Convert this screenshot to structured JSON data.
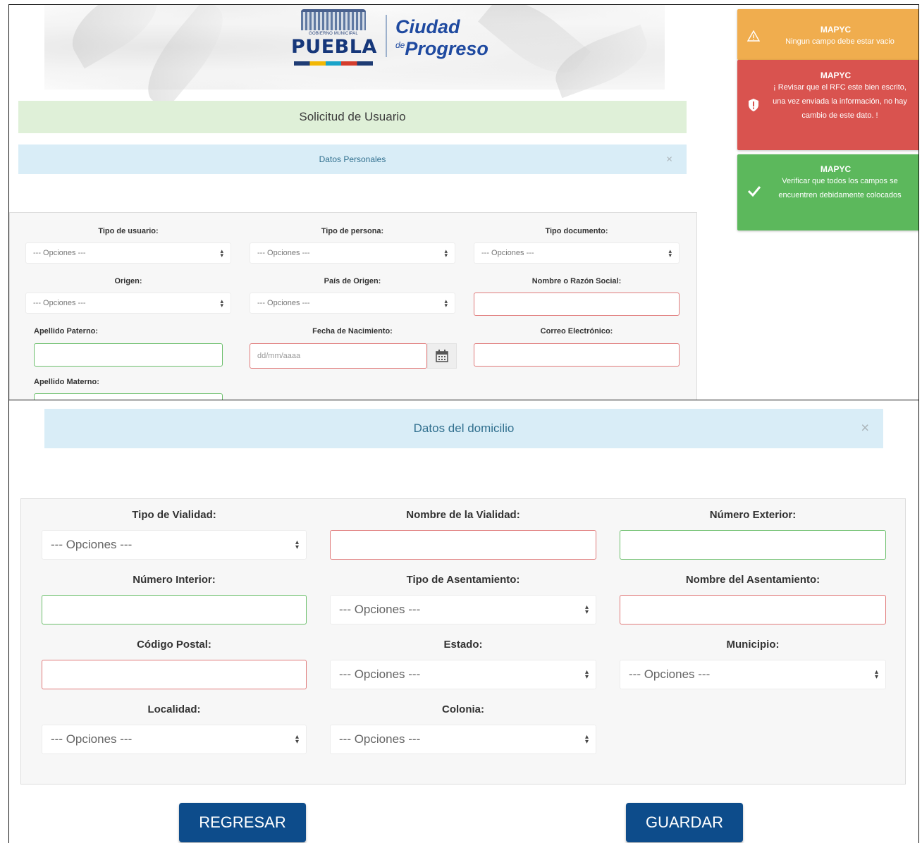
{
  "header": {
    "gov_caption": "GOBIERNO MUNICIPAL",
    "city_name": "PUEBLA",
    "slogan_line1": "Ciudad",
    "slogan_de": "de",
    "slogan_line2": "Progreso"
  },
  "request_title": "Solicitud de Usuario",
  "personal_section": {
    "title": "Datos Personales",
    "close": "×",
    "fields": {
      "user_type_label": "Tipo de usuario:",
      "user_type_value": "--- Opciones ---",
      "person_type_label": "Tipo de persona:",
      "person_type_value": "--- Opciones ---",
      "document_type_label": "Tipo documento:",
      "document_type_value": "--- Opciones ---",
      "origin_label": "Origen:",
      "origin_value": "--- Opciones ---",
      "country_label": "País de Origen:",
      "country_value": "--- Opciones ---",
      "name_label": "Nombre o Razón Social:",
      "paternal_label": "Apellido Paterno:",
      "birthdate_label": "Fecha de Nacimiento:",
      "birthdate_placeholder": "dd/mm/aaaa",
      "email_label": "Correo Electrónico:",
      "maternal_label": "Apellido Materno:"
    }
  },
  "notifications": [
    {
      "title": "MAPYC",
      "message": "Ningun campo debe estar vacio",
      "color": "#f0ad4e",
      "icon": "warning-icon"
    },
    {
      "title": "MAPYC",
      "message": "¡ Revisar que el RFC este bien escrito, una vez enviada la información, no hay cambio de este dato. !",
      "color": "#d9534f",
      "icon": "shield-alert-icon"
    },
    {
      "title": "MAPYC",
      "message": "Verificar que todos los campos se encuentren debidamente colocados",
      "color": "#5cb85c",
      "icon": "check-icon"
    }
  ],
  "address_section": {
    "title": "Datos del domicilio",
    "close": "×",
    "fields": {
      "road_type_label": "Tipo de Vialidad:",
      "road_type_value": "--- Opciones ---",
      "road_name_label": "Nombre de la Vialidad:",
      "ext_number_label": "Número Exterior:",
      "int_number_label": "Número Interior:",
      "settlement_type_label": "Tipo de Asentamiento:",
      "settlement_type_value": "--- Opciones ---",
      "settlement_name_label": "Nombre del Asentamiento:",
      "zip_label": "Código Postal:",
      "state_label": "Estado:",
      "state_value": "--- Opciones ---",
      "municipality_label": "Municipio:",
      "municipality_value": "--- Opciones ---",
      "locality_label": "Localidad:",
      "locality_value": "--- Opciones ---",
      "colony_label": "Colonia:",
      "colony_value": "--- Opciones ---"
    }
  },
  "buttons": {
    "back": "REGRESAR",
    "save": "GUARDAR"
  },
  "colors": {
    "primary_button": "#0d4c8b",
    "invalid_border": "#e07a7a",
    "valid_border": "#6cbf6c"
  }
}
